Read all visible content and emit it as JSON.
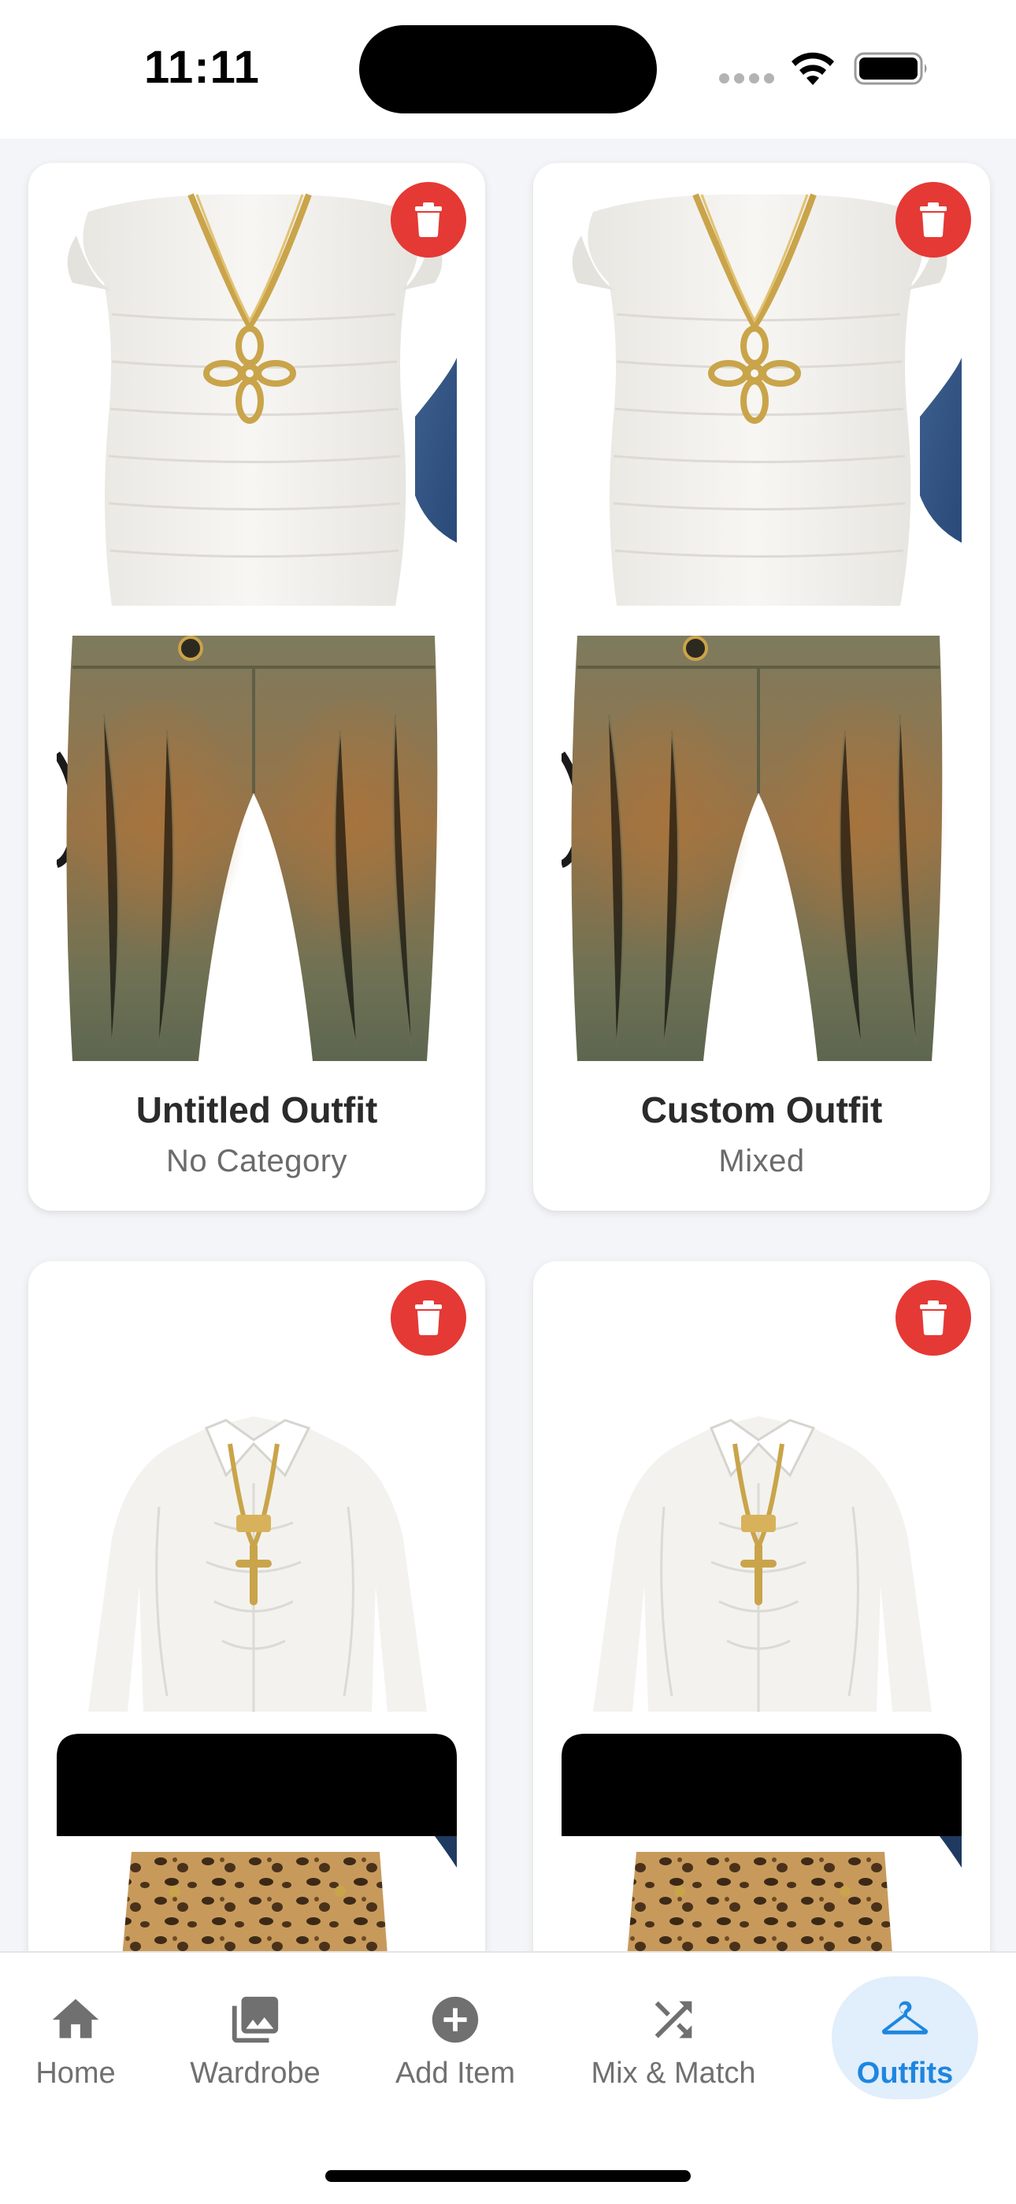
{
  "status_bar": {
    "time": "11:11"
  },
  "outfits": [
    {
      "title": "Untitled Outfit",
      "category": "No Category"
    },
    {
      "title": "Custom Outfit",
      "category": "Mixed"
    },
    {
      "title": "",
      "category": ""
    },
    {
      "title": "",
      "category": ""
    }
  ],
  "nav": {
    "items": [
      {
        "label": "Home",
        "icon": "home-icon"
      },
      {
        "label": "Wardrobe",
        "icon": "photo-library-icon"
      },
      {
        "label": "Add Item",
        "icon": "add-circle-icon"
      },
      {
        "label": "Mix & Match",
        "icon": "shuffle-icon"
      },
      {
        "label": "Outfits",
        "icon": "hanger-icon",
        "active": true
      }
    ]
  },
  "colors": {
    "accent": "#1e86e0",
    "delete": "#e53935",
    "background": "#f4f5f8"
  }
}
